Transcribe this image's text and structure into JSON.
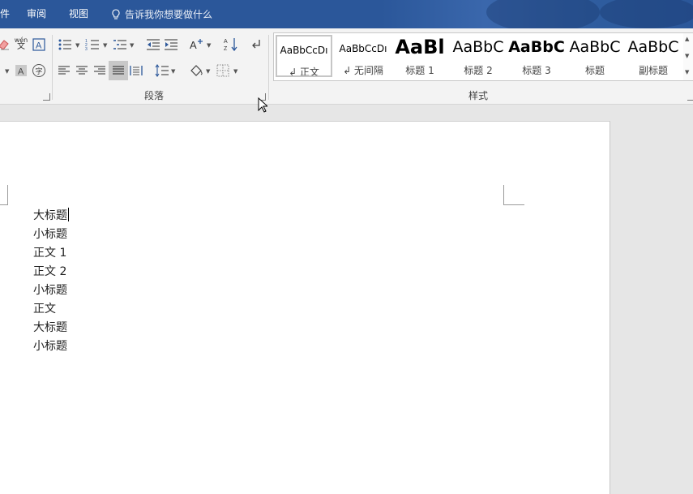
{
  "menu": {
    "items": [
      {
        "label": "件"
      },
      {
        "label": "审阅"
      },
      {
        "label": "视图"
      }
    ],
    "tellme": "告诉我你想要做什么"
  },
  "ribbon": {
    "paragraph_label": "段落",
    "styles_label": "样式",
    "font_tools": {
      "phonetic_top": "wén",
      "phonetic_bottom": "文",
      "enclose_char": "字"
    },
    "styles": [
      {
        "sample": "AaBbCcDı",
        "name": "↲ 正文",
        "selected": true
      },
      {
        "sample": "AaBbCcDı",
        "name": "↲ 无间隔",
        "selected": false
      },
      {
        "sample": "AaBl",
        "name": "标题 1",
        "selected": false
      },
      {
        "sample": "AaBbC",
        "name": "标题 2",
        "selected": false
      },
      {
        "sample": "AaBbC",
        "name": "标题 3",
        "selected": false
      },
      {
        "sample": "AaBbC",
        "name": "标题",
        "selected": false
      },
      {
        "sample": "AaBbC",
        "name": "副标题",
        "selected": false
      }
    ]
  },
  "document": {
    "lines": [
      "大标题",
      "小标题",
      "正文 1",
      "正文 2",
      "小标题",
      "正文",
      "大标题",
      "小标题"
    ]
  },
  "colors": {
    "accent": "#2b579a",
    "ribbon": "#f3f3f3",
    "canvas": "#e6e6e6"
  }
}
